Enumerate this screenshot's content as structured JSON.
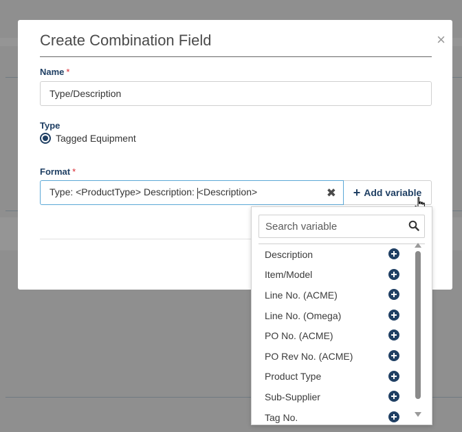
{
  "dialog": {
    "title": "Create Combination Field",
    "close_glyph": "×"
  },
  "name_field": {
    "label": "Name",
    "required_mark": "*",
    "value": "Type/Description"
  },
  "type_field": {
    "label": "Type",
    "selected_option": "Tagged Equipment"
  },
  "format_field": {
    "label": "Format",
    "required_mark": "*",
    "value_before_caret": "Type: <ProductType> Description: ",
    "value_after_caret": "<Description>",
    "clear_glyph": "✖",
    "add_variable_plus": "+",
    "add_variable_label": "Add variable"
  },
  "variable_dropdown": {
    "search_placeholder": "Search variable",
    "items": [
      {
        "label": "Description"
      },
      {
        "label": "Item/Model"
      },
      {
        "label": "Line No. (ACME)"
      },
      {
        "label": "Line No. (Omega)"
      },
      {
        "label": "PO No. (ACME)"
      },
      {
        "label": "PO Rev No. (ACME)"
      },
      {
        "label": "Product Type"
      },
      {
        "label": "Sub-Supplier"
      },
      {
        "label": "Tag No."
      }
    ]
  },
  "colors": {
    "accent": "#1f3f63",
    "required": "#d9262e",
    "focus_border": "#5aa7d6",
    "overlay": "#8f8f8f"
  },
  "icons": {
    "close": "close-icon",
    "clear": "clear-icon",
    "add": "plus-circle-icon",
    "search": "magnifier-icon",
    "cursor": "hand-pointer-icon"
  }
}
